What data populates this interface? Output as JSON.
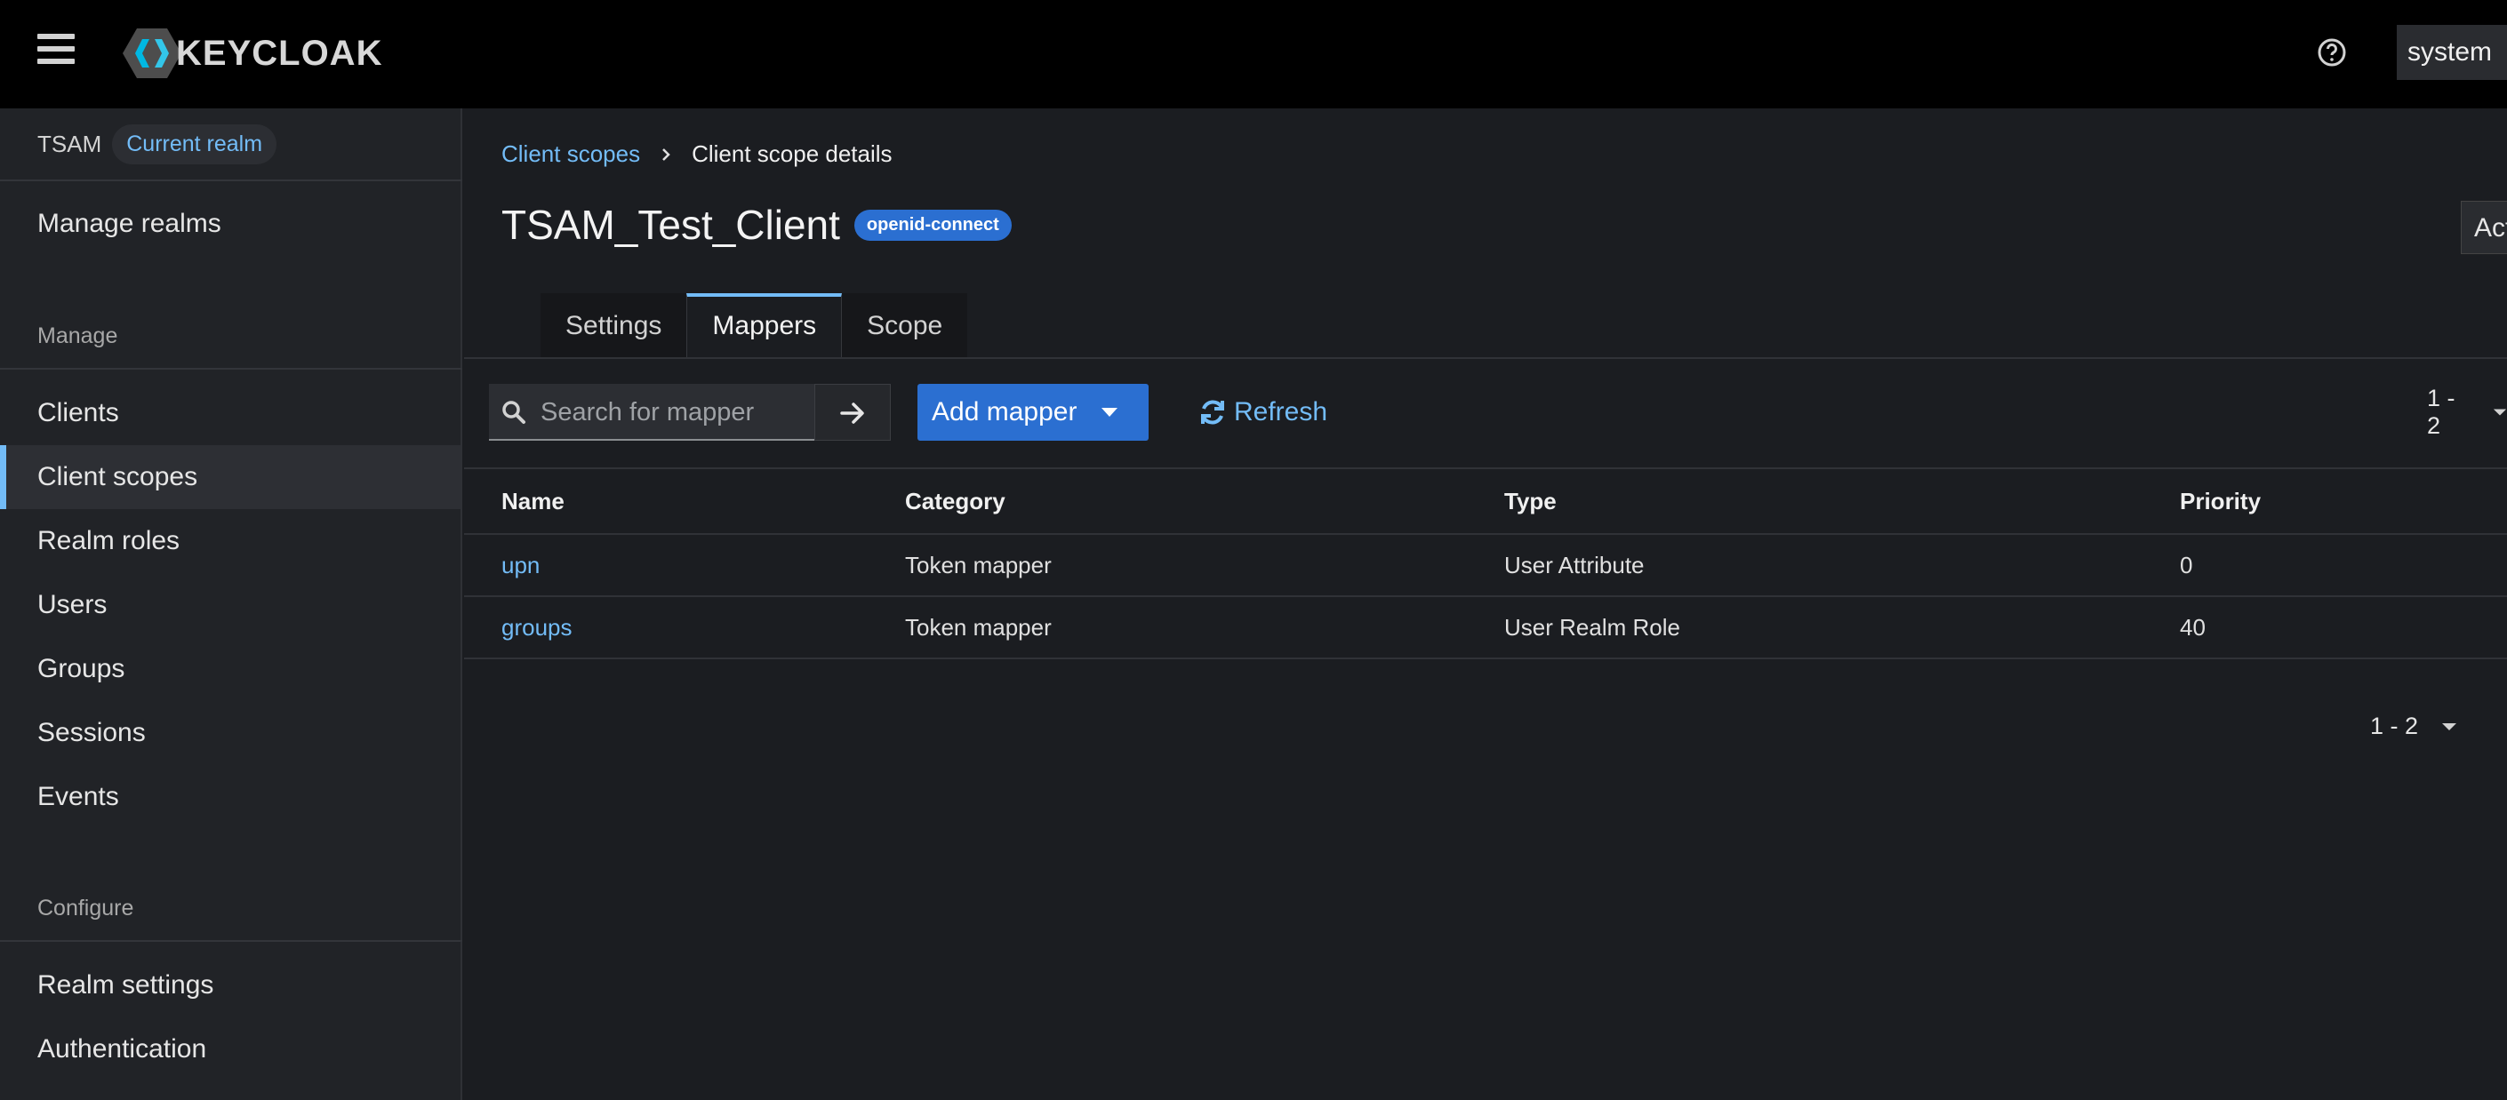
{
  "masthead": {
    "brand": "KEYCLOAK",
    "user": "system"
  },
  "sidebar": {
    "realm_name": "TSAM",
    "realm_badge": "Current realm",
    "manage_realms": "Manage realms",
    "manage_section": "Manage",
    "manage_items": [
      "Clients",
      "Client scopes",
      "Realm roles",
      "Users",
      "Groups",
      "Sessions",
      "Events"
    ],
    "configure_section": "Configure",
    "configure_items": [
      "Realm settings",
      "Authentication"
    ]
  },
  "breadcrumb": {
    "parent": "Client scopes",
    "current": "Client scope details"
  },
  "header": {
    "title": "TSAM_Test_Client",
    "protocol_badge": "openid-connect",
    "action_label": "Action"
  },
  "tabs": [
    "Settings",
    "Mappers",
    "Scope"
  ],
  "toolbar": {
    "search_placeholder": "Search for mapper",
    "add_mapper": "Add mapper",
    "refresh": "Refresh",
    "pagination": "1 - 2"
  },
  "table": {
    "columns": [
      "Name",
      "Category",
      "Type",
      "Priority"
    ],
    "rows": [
      {
        "name": "upn",
        "category": "Token mapper",
        "type": "User Attribute",
        "priority": "0"
      },
      {
        "name": "groups",
        "category": "Token mapper",
        "type": "User Realm Role",
        "priority": "40"
      }
    ]
  },
  "footer": {
    "pagination": "1 - 2"
  },
  "colors": {
    "accent": "#73bcf7",
    "primary": "#2b6fd1",
    "masthead": "#000000",
    "background": "#1b1d21"
  }
}
